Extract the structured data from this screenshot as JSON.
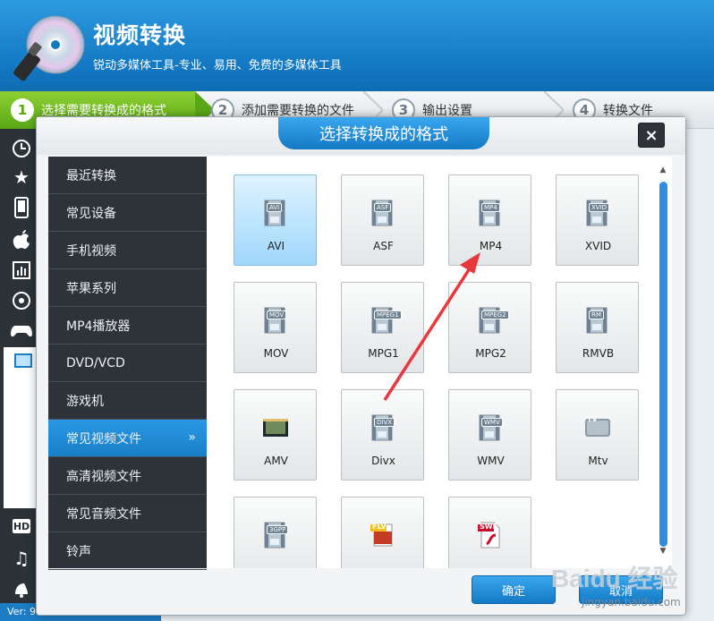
{
  "app": {
    "title": "视频转换",
    "subtitle": "锐动多媒体工具-专业、易用、免费的多媒体工具",
    "version": "Ver: 9."
  },
  "steps": [
    {
      "num": "1",
      "label": "选择需要转换成的格式"
    },
    {
      "num": "2",
      "label": "添加需要转换的文件"
    },
    {
      "num": "3",
      "label": "输出设置"
    },
    {
      "num": "4",
      "label": "转换文件"
    }
  ],
  "toolbar": {
    "icons": [
      "clock-icon",
      "star-icon",
      "phone-icon",
      "apple-icon",
      "chart-icon",
      "disc-icon",
      "gamepad-icon",
      "video-icon",
      "hd-icon",
      "music-icon",
      "ringtone-icon"
    ],
    "hd_label": "HD"
  },
  "dialog": {
    "title": "选择转换成的格式",
    "close_label": "×",
    "ok_label": "确定",
    "cancel_label": "取消"
  },
  "categories": [
    {
      "label": "最近转换",
      "active": false
    },
    {
      "label": "常见设备",
      "active": false
    },
    {
      "label": "手机视频",
      "active": false
    },
    {
      "label": "苹果系列",
      "active": false
    },
    {
      "label": "MP4播放器",
      "active": false
    },
    {
      "label": "DVD/VCD",
      "active": false
    },
    {
      "label": "游戏机",
      "active": false
    },
    {
      "label": "常见视频文件",
      "active": true,
      "chevron": "»"
    },
    {
      "label": "高清视频文件",
      "active": false
    },
    {
      "label": "常见音频文件",
      "active": false
    },
    {
      "label": "铃声",
      "active": false
    }
  ],
  "formats": [
    {
      "label": "AVI",
      "badge": "AVI",
      "selected": true
    },
    {
      "label": "ASF",
      "badge": "ASF",
      "selected": false
    },
    {
      "label": "MP4",
      "badge": "MP4",
      "selected": false
    },
    {
      "label": "XVID",
      "badge": "XVID",
      "selected": false
    },
    {
      "label": "MOV",
      "badge": "MOV",
      "selected": false
    },
    {
      "label": "MPG1",
      "badge": "MPEG1",
      "selected": false
    },
    {
      "label": "MPG2",
      "badge": "MPEG2",
      "selected": false
    },
    {
      "label": "RMVB",
      "badge": "RM",
      "selected": false
    },
    {
      "label": "AMV",
      "badge": "",
      "selected": false
    },
    {
      "label": "Divx",
      "badge": "DIVX",
      "selected": false
    },
    {
      "label": "WMV",
      "badge": "WMV",
      "selected": false
    },
    {
      "label": "Mtv",
      "badge": "TV",
      "selected": false
    },
    {
      "label": "",
      "badge": "3GPP",
      "selected": false
    },
    {
      "label": "",
      "badge": "FLV",
      "selected": false
    },
    {
      "label": "",
      "badge": "SWF",
      "selected": false
    }
  ],
  "watermark": {
    "text": "jingyan.baidu.com",
    "brand": "Baidu 经验"
  },
  "colors": {
    "accent": "#1a7fc7",
    "step_active": "#6ab424",
    "sidebar": "#2d3338",
    "annotation": "#e8383d"
  }
}
